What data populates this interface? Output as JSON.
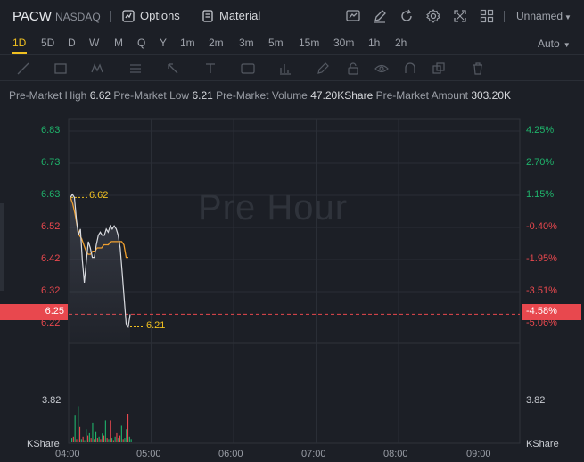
{
  "header": {
    "symbol": "PACW",
    "exchange": "NASDAQ",
    "options_label": "Options",
    "material_label": "Material",
    "layout_name": "Unnamed"
  },
  "periods": [
    "1D",
    "5D",
    "D",
    "W",
    "M",
    "Q",
    "Y",
    "1m",
    "2m",
    "3m",
    "5m",
    "15m",
    "30m",
    "1h",
    "2h"
  ],
  "active_period": "1D",
  "auto_label": "Auto",
  "premarket": {
    "high_label": "Pre-Market High",
    "high": "6.62",
    "low_label": "Pre-Market Low",
    "low": "6.21",
    "volume_label": "Pre-Market Volume",
    "volume": "47.20KShare",
    "amount_label": "Pre-Market Amount",
    "amount": "303.20K"
  },
  "chart": {
    "watermark": "Pre Hour",
    "price_labels": [
      "6.83",
      "6.73",
      "6.63",
      "6.52",
      "6.42",
      "6.32",
      "6.22"
    ],
    "pct_labels": [
      "4.25%",
      "2.70%",
      "1.15%",
      "-0.40%",
      "-1.95%",
      "-3.51%",
      "-5.06%"
    ],
    "current_price": "6.25",
    "current_pct": "-4.58%",
    "high_note": "6.62",
    "low_note": "6.21",
    "volume_left": "3.82",
    "volume_right": "3.82",
    "volume_unit_left": "KShare",
    "volume_unit_right": "KShare",
    "x_labels": [
      "04:00",
      "05:00",
      "06:00",
      "07:00",
      "08:00",
      "09:00"
    ],
    "colors": {
      "up": "#1fb36b",
      "down": "#e8484e",
      "line": "#d9dbe0",
      "avg": "#f0a030",
      "accent": "#f0c020"
    }
  },
  "chart_data": {
    "type": "line",
    "title": "",
    "xlabel": "",
    "ylabel": "",
    "x_ticks": [
      "04:00",
      "05:00",
      "06:00",
      "07:00",
      "08:00",
      "09:00"
    ],
    "ylim": [
      6.22,
      6.83
    ],
    "series": [
      {
        "values": [
          6.62,
          6.63,
          6.62,
          6.55,
          6.5,
          6.52,
          6.42,
          6.35,
          6.42,
          6.48,
          6.46,
          6.43,
          6.43,
          6.47,
          6.5,
          6.51,
          6.5,
          6.5,
          6.52,
          6.51,
          6.53,
          6.52,
          6.53,
          6.52,
          6.5,
          6.46,
          6.38,
          6.3,
          6.22,
          6.21,
          6.25
        ]
      },
      {
        "values": [
          6.62,
          6.6,
          6.57,
          6.53,
          6.5,
          6.49,
          6.47,
          6.45,
          6.44,
          6.44,
          6.45,
          6.45,
          6.46,
          6.46,
          6.46,
          6.47,
          6.47,
          6.47,
          6.48,
          6.48,
          6.48,
          6.48,
          6.48,
          6.48,
          6.47,
          6.43,
          6.43
        ]
      }
    ],
    "volume_max": 3.82,
    "volume": [
      {
        "v": 0.4,
        "d": "up"
      },
      {
        "v": 0.5,
        "d": "down"
      },
      {
        "v": 2.5,
        "d": "up"
      },
      {
        "v": 0.3,
        "d": "down"
      },
      {
        "v": 3.3,
        "d": "up"
      },
      {
        "v": 1.4,
        "d": "down"
      },
      {
        "v": 0.3,
        "d": "up"
      },
      {
        "v": 0.5,
        "d": "down"
      },
      {
        "v": 0.2,
        "d": "up"
      },
      {
        "v": 1.2,
        "d": "up"
      },
      {
        "v": 0.6,
        "d": "down"
      },
      {
        "v": 0.9,
        "d": "up"
      },
      {
        "v": 0.4,
        "d": "down"
      },
      {
        "v": 1.8,
        "d": "up"
      },
      {
        "v": 0.3,
        "d": "down"
      },
      {
        "v": 1.0,
        "d": "up"
      },
      {
        "v": 0.4,
        "d": "down"
      },
      {
        "v": 0.5,
        "d": "up"
      },
      {
        "v": 0.3,
        "d": "down"
      },
      {
        "v": 0.8,
        "d": "up"
      },
      {
        "v": 0.6,
        "d": "down"
      },
      {
        "v": 2.0,
        "d": "up"
      },
      {
        "v": 0.4,
        "d": "down"
      },
      {
        "v": 0.3,
        "d": "up"
      },
      {
        "v": 2.0,
        "d": "down"
      },
      {
        "v": 0.4,
        "d": "up"
      },
      {
        "v": 0.2,
        "d": "down"
      },
      {
        "v": 0.5,
        "d": "up"
      },
      {
        "v": 0.9,
        "d": "down"
      },
      {
        "v": 0.4,
        "d": "up"
      },
      {
        "v": 0.6,
        "d": "down"
      },
      {
        "v": 1.5,
        "d": "up"
      },
      {
        "v": 0.3,
        "d": "down"
      },
      {
        "v": 0.4,
        "d": "up"
      },
      {
        "v": 1.2,
        "d": "up"
      },
      {
        "v": 2.6,
        "d": "down"
      },
      {
        "v": 0.5,
        "d": "up"
      },
      {
        "v": 0.3,
        "d": "up"
      }
    ]
  }
}
